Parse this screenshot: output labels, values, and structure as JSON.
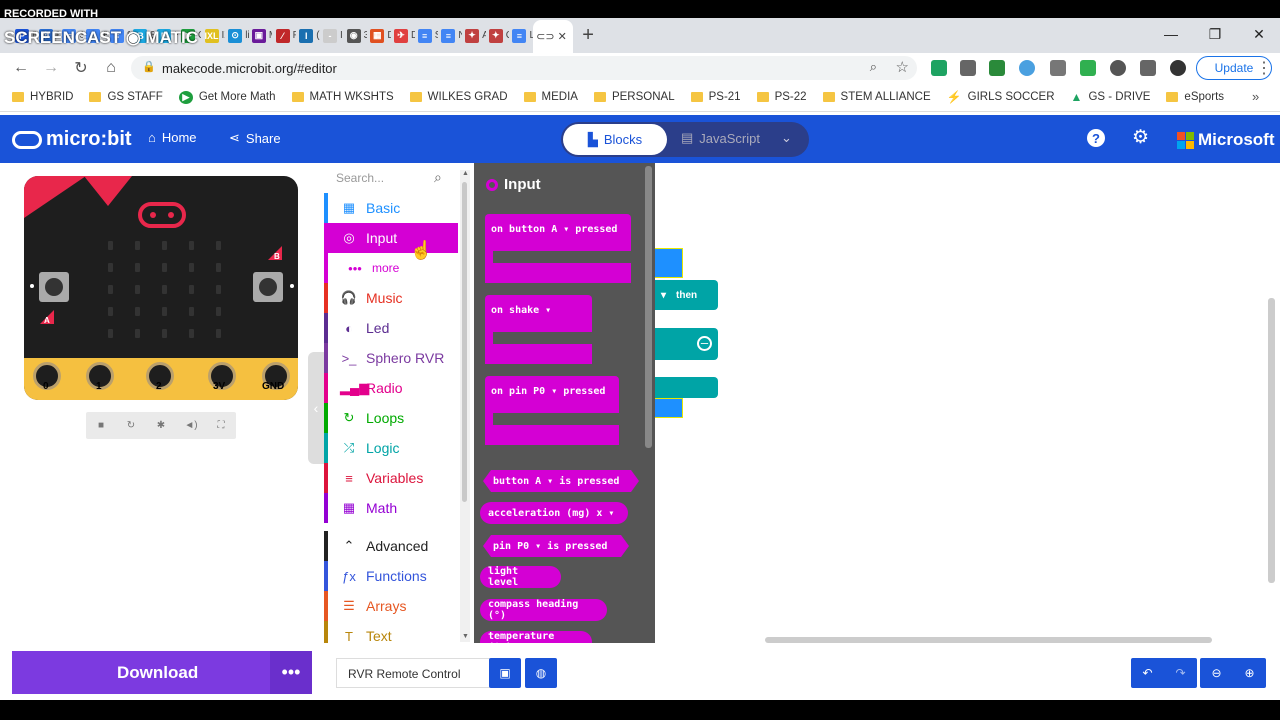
{
  "browser": {
    "tabs": [
      {
        "label": "Pc",
        "color": "#1a53d8",
        "glyph": "P"
      },
      {
        "label": "PS",
        "color": "#2a6fd6",
        "glyph": "⚙"
      },
      {
        "label": "Sc",
        "color": "#4285f4",
        "glyph": "≡"
      },
      {
        "label": "Re",
        "color": "#4285f4",
        "glyph": "≡"
      },
      {
        "label": "Sc",
        "color": "#4285f4",
        "glyph": "≡"
      },
      {
        "label": "Bl",
        "color": "#1ca7e0",
        "glyph": "B"
      },
      {
        "label": "H",
        "color": "#1ca7e0",
        "glyph": "B"
      },
      {
        "label": "G",
        "color": "#1e9e3e",
        "glyph": "▶"
      },
      {
        "label": "IX",
        "color": "#e0c020",
        "glyph": "IXL"
      },
      {
        "label": "lit",
        "color": "#1a8fd6",
        "glyph": "⊙"
      },
      {
        "label": "M",
        "color": "#6a1b9a",
        "glyph": "▣"
      },
      {
        "label": "Fc",
        "color": "#c0282a",
        "glyph": "⁄"
      },
      {
        "label": "(C",
        "color": "#1a6fb0",
        "glyph": "I"
      },
      {
        "label": "IL",
        "color": "#cccccc",
        "glyph": "-"
      },
      {
        "label": "31",
        "color": "#555555",
        "glyph": "◉"
      },
      {
        "label": "D",
        "color": "#e05020",
        "glyph": "▦"
      },
      {
        "label": "D",
        "color": "#e04040",
        "glyph": "✈"
      },
      {
        "label": "Sc",
        "color": "#4285f4",
        "glyph": "≡"
      },
      {
        "label": "N",
        "color": "#4285f4",
        "glyph": "≡"
      },
      {
        "label": "A",
        "color": "#c04040",
        "glyph": "✦"
      },
      {
        "label": "Cl",
        "color": "#c04040",
        "glyph": "✦"
      },
      {
        "label": "LC",
        "color": "#4285f4",
        "glyph": "≡"
      }
    ],
    "active_tab_icon": "microbit-tab-icon",
    "url": "makecode.microbit.org/#editor",
    "update_label": "Update",
    "bookmarks": [
      "HYBRID",
      "GS STAFF",
      "Get More Math",
      "MATH WKSHTS",
      "WILKES GRAD",
      "MEDIA",
      "PERSONAL",
      "PS-21",
      "PS-22",
      "STEM ALLIANCE",
      "GIRLS SOCCER",
      "GS - DRIVE",
      "eSports"
    ]
  },
  "header": {
    "logo": "micro:bit",
    "home": "Home",
    "share": "Share",
    "blocks": "Blocks",
    "javascript": "JavaScript",
    "microsoft": "Microsoft"
  },
  "simulator": {
    "pins": [
      "0",
      "1",
      "2",
      "3V",
      "GND"
    ],
    "button_a": "A",
    "button_b": "B"
  },
  "toolbox": {
    "search_placeholder": "Search...",
    "categories": [
      {
        "label": "Basic",
        "color": "#1e90ff",
        "icon": "grid-icon"
      },
      {
        "label": "Input",
        "color": "#d400d4",
        "icon": "target-icon"
      },
      {
        "label": "more",
        "color": "#d400d4",
        "icon": "dots-icon"
      },
      {
        "label": "Music",
        "color": "#e63022",
        "icon": "headphones-icon"
      },
      {
        "label": "Led",
        "color": "#5c2d91",
        "icon": "toggle-icon"
      },
      {
        "label": "Sphero RVR",
        "color": "#7b3aa0",
        "icon": "terminal-icon"
      },
      {
        "label": "Radio",
        "color": "#e3008c",
        "icon": "signal-icon"
      },
      {
        "label": "Loops",
        "color": "#00aa00",
        "icon": "refresh-icon"
      },
      {
        "label": "Logic",
        "color": "#00a4a6",
        "icon": "shuffle-icon"
      },
      {
        "label": "Variables",
        "color": "#dc143c",
        "icon": "list-icon"
      },
      {
        "label": "Math",
        "color": "#9400d3",
        "icon": "calculator-icon"
      },
      {
        "label": "Advanced",
        "color": "#222222",
        "icon": "chevron-up-icon"
      },
      {
        "label": "Functions",
        "color": "#3455db",
        "icon": "function-icon"
      },
      {
        "label": "Arrays",
        "color": "#e65722",
        "icon": "arrays-icon"
      },
      {
        "label": "Text",
        "color": "#b8860b",
        "icon": "text-icon"
      }
    ]
  },
  "flyout": {
    "title": "Input",
    "blocks": {
      "on_button": "on button  A ▾  pressed",
      "on_shake": "on  shake ▾",
      "on_pin": "on pin  P0 ▾  pressed",
      "button_is_pressed": "button  A ▾  is pressed",
      "acceleration": "acceleration (mg)  x ▾",
      "pin_is_pressed": "pin  P0 ▾  is pressed",
      "light_level": "light level",
      "compass_heading": "compass heading (°)",
      "temperature": "temperature (°C)"
    }
  },
  "workspace": {
    "then_label": "then"
  },
  "bottom": {
    "download": "Download",
    "project_name": "RVR Remote Control",
    "recorded_with": "RECORDED WITH",
    "screencast": "SCREENCAST ◉ MATIC"
  }
}
